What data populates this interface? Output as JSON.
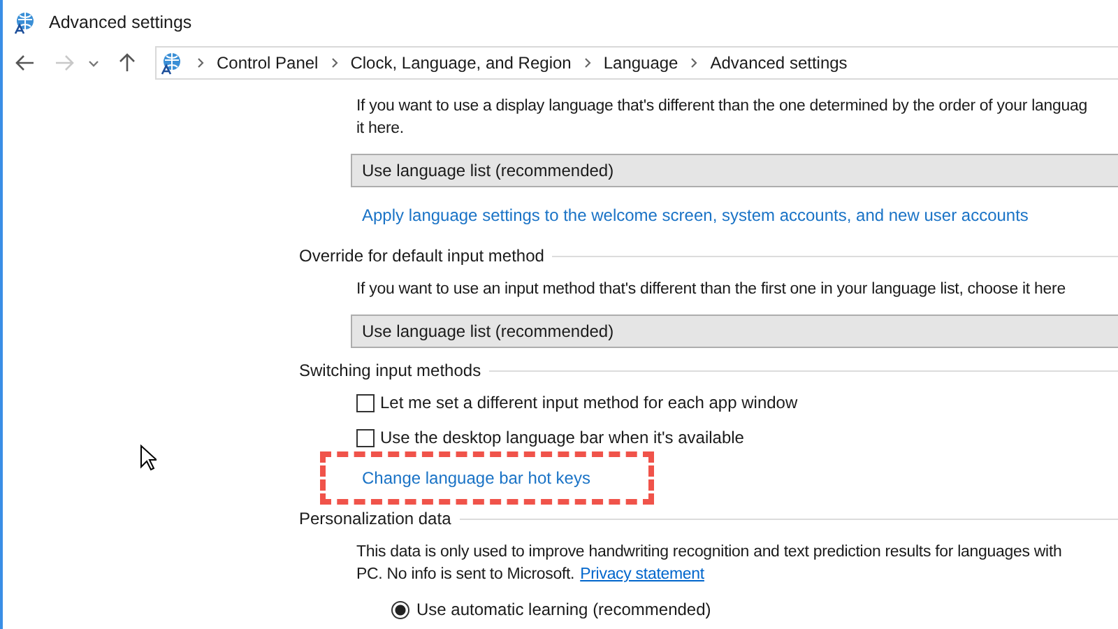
{
  "window": {
    "title": "Advanced settings"
  },
  "address_bar": {
    "crumbs": [
      "Control Panel",
      "Clock, Language, and Region",
      "Language",
      "Advanced settings"
    ]
  },
  "sections": [
    {
      "items": [
        {
          "kind": "text",
          "lines": [
            "If you want to use a display language that's different than the one determined by the order of your languag",
            "it here."
          ]
        },
        {
          "kind": "dropdown",
          "value": "Use language list (recommended)"
        },
        {
          "kind": "link",
          "label": "Apply language settings to the welcome screen, system accounts, and new user accounts",
          "highlighted": false
        }
      ]
    },
    {
      "heading": "Override for default input method",
      "items": [
        {
          "kind": "text",
          "lines": [
            "If you want to use an input method that's different than the first one in your language list, choose it here"
          ]
        },
        {
          "kind": "dropdown",
          "value": "Use language list (recommended)"
        }
      ]
    },
    {
      "heading": "Switching input methods",
      "items": [
        {
          "kind": "checkbox",
          "label": "Let me set a different input method for each app window",
          "checked": false
        },
        {
          "kind": "checkbox",
          "label": "Use the desktop language bar when it's available",
          "checked": false
        },
        {
          "kind": "link",
          "label": "Change language bar hot keys",
          "highlighted": true
        }
      ]
    },
    {
      "heading": "Personalization data",
      "items": [
        {
          "kind": "text",
          "lines": [
            "This data is only used to improve handwriting recognition and text prediction results for languages with",
            "PC. No info is sent to Microsoft."
          ],
          "link": "Privacy statement"
        },
        {
          "kind": "radio",
          "label": "Use automatic learning (recommended)",
          "selected": true
        }
      ]
    }
  ]
}
